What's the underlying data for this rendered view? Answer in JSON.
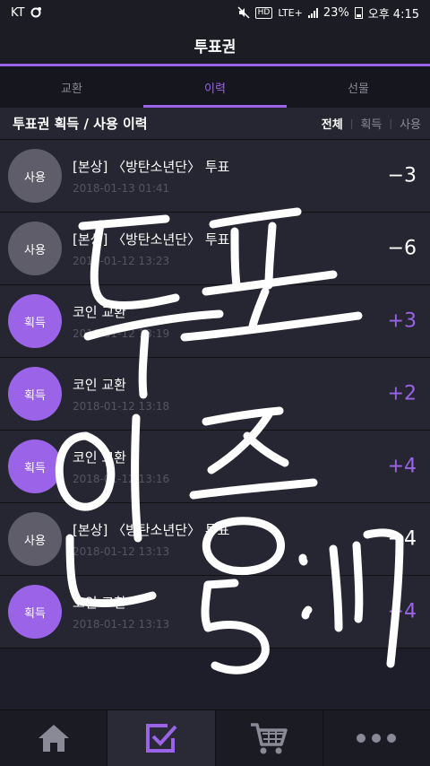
{
  "status": {
    "carrier": "KT",
    "network": "LTE+",
    "hd": "HD",
    "battery": "23%",
    "time": "오후 4:15"
  },
  "header": {
    "title": "투표권"
  },
  "tabs": [
    {
      "label": "교환",
      "active": false
    },
    {
      "label": "이력",
      "active": true
    },
    {
      "label": "선물",
      "active": false
    }
  ],
  "list_header": {
    "title": "투표권 획득 / 사용 이력",
    "filters": [
      "전체",
      "획득",
      "사용"
    ],
    "active_filter": "전체"
  },
  "history": [
    {
      "badge": "사용",
      "type": "use",
      "title": "[본상] 〈방탄소년단〉 투표",
      "date": "2018-01-13 01:41",
      "amount": "−3"
    },
    {
      "badge": "사용",
      "type": "use",
      "title": "[본상] 〈방탄소년단〉 투표",
      "date": "2018-01-12 13:23",
      "amount": "−6"
    },
    {
      "badge": "획득",
      "type": "gain",
      "title": "코인 교환",
      "date": "2018-01-12 13:19",
      "amount": "+3"
    },
    {
      "badge": "획득",
      "type": "gain",
      "title": "코인 교환",
      "date": "2018-01-12 13:18",
      "amount": "+2"
    },
    {
      "badge": "획득",
      "type": "gain",
      "title": "코인 교환",
      "date": "2018-01-12 13:16",
      "amount": "+4"
    },
    {
      "badge": "사용",
      "type": "use",
      "title": "[본상] 〈방탄소년단〉 투표",
      "date": "2018-01-12 13:13",
      "amount": "−4"
    },
    {
      "badge": "획득",
      "type": "gain",
      "title": "코인 교환",
      "date": "2018-01-12 13:13",
      "amount": "+4"
    }
  ],
  "bottom_nav": [
    {
      "icon": "home-icon",
      "active": false
    },
    {
      "icon": "vote-check-icon",
      "active": true
    },
    {
      "icon": "cart-icon",
      "active": false
    },
    {
      "icon": "more-icon",
      "active": false
    }
  ],
  "colors": {
    "accent": "#9a63e8",
    "background": "#1e1e2a",
    "row_background": "#262633",
    "use_badge": "#5f5d69"
  },
  "handwriting": {
    "text": "투표 인증 5:17"
  }
}
